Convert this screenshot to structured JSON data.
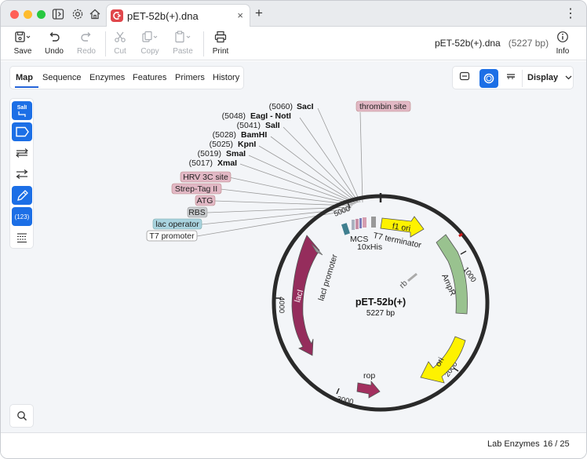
{
  "window": {
    "tab_title": "pET-52b(+).dna",
    "close_glyph": "×",
    "add_glyph": "+",
    "menu_glyph": "⋮",
    "icons": [
      "sidebar-toggle-icon",
      "gear-icon",
      "home-icon"
    ]
  },
  "toolbar": {
    "save": "Save",
    "undo": "Undo",
    "redo": "Redo",
    "cut": "Cut",
    "copy": "Copy",
    "paste": "Paste",
    "print": "Print",
    "info": "Info",
    "doc_name": "pET-52b(+).dna",
    "doc_length": "(5227 bp)"
  },
  "view_tabs": [
    "Map",
    "Sequence",
    "Enzymes",
    "Features",
    "Primers",
    "History"
  ],
  "active_view_tab": "Map",
  "display_button": "Display",
  "sidebar": {
    "enzyme_set_badge": "SalI",
    "numbers_badge": "(123)"
  },
  "map": {
    "name": "pET-52b(+)",
    "length_label": "5227 bp",
    "ticks": [
      "1000",
      "2000",
      "3000",
      "4000",
      "5000"
    ],
    "enzymes": [
      {
        "pos": "(5060)",
        "name": "SacI"
      },
      {
        "pos": "(5048)",
        "name": "EagI - NotI"
      },
      {
        "pos": "(5041)",
        "name": "SalI"
      },
      {
        "pos": "(5028)",
        "name": "BamHI"
      },
      {
        "pos": "(5025)",
        "name": "KpnI"
      },
      {
        "pos": "(5019)",
        "name": "SmaI"
      },
      {
        "pos": "(5017)",
        "name": "XmaI"
      }
    ],
    "feature_labels_left": [
      "HRV 3C site",
      "Strep-Tag II",
      "ATG",
      "RBS",
      "lac operator",
      "T7 promoter"
    ],
    "feature_label_top": "thrombin site",
    "features": {
      "f1_ori": "f1 ori",
      "ampr": "AmpR",
      "ori": "ori",
      "rop": "rop",
      "laci": "lacI",
      "laci_promoter": "lacI promoter",
      "mcs": "MCS",
      "his": "10xHis",
      "t7_terminator": "T7 terminator",
      "rb": "rb"
    },
    "colors": {
      "ori": "#fef200",
      "ampr": "#99c28f",
      "laci": "#952d5c",
      "rop": "#a3305f",
      "site": "#e2b8c5",
      "operator": "#a9d3df",
      "promoter": "#ffffff",
      "rbs": "#c7cacd"
    }
  },
  "status": {
    "enzyme_set": "Lab Enzymes",
    "count": "16 / 25"
  }
}
